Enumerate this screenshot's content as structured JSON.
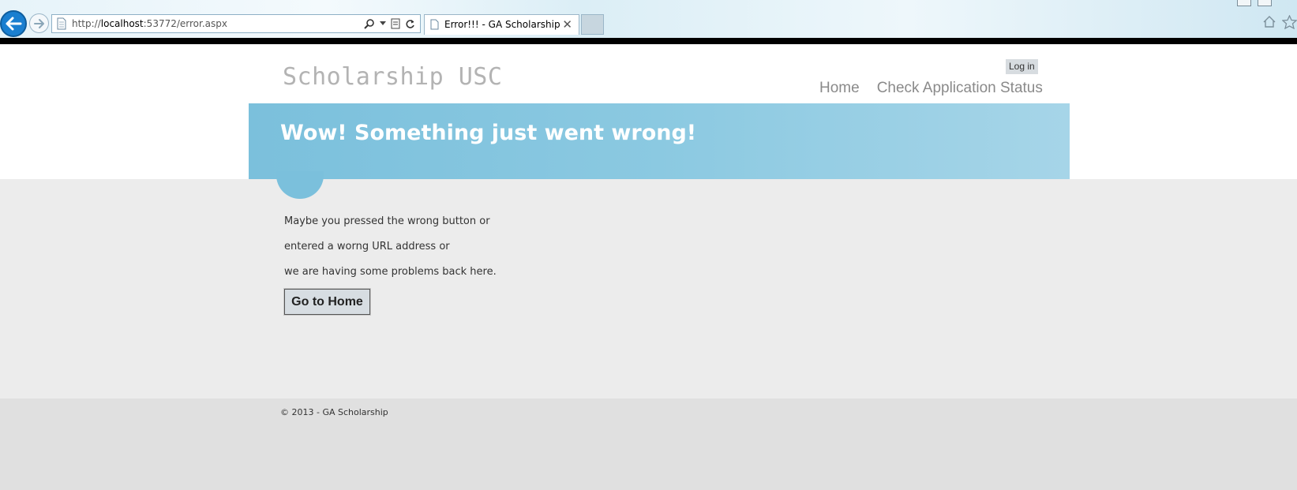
{
  "browser": {
    "url_prefix": "http://",
    "url_host": "localhost",
    "url_rest": ":53772/error.aspx",
    "tab_title": "Error!!! - GA Scholarship",
    "tab_close": "✕"
  },
  "header": {
    "site_title": "Scholarship USC",
    "login_label": "Log in",
    "nav": [
      {
        "label": "Home"
      },
      {
        "label": "Check Application Status"
      }
    ]
  },
  "banner": {
    "title": "Wow! Something just went wrong!"
  },
  "main": {
    "messages": [
      "Maybe you pressed the wrong button or",
      "entered a worng URL address or",
      "we are having some problems back here."
    ],
    "home_button_label": "Go to Home"
  },
  "footer": {
    "copyright": "© 2013 - GA Scholarship"
  },
  "colors": {
    "banner": "#7bc0dc",
    "content_bg": "#ececec",
    "footer_bg": "#e0e0e0",
    "back_button": "#1a7fd0"
  },
  "icons": [
    "back-arrow-icon",
    "forward-arrow-icon",
    "page-icon",
    "search-icon",
    "dropdown-icon",
    "compat-view-icon",
    "refresh-icon",
    "home-icon",
    "favorites-star-icon"
  ]
}
